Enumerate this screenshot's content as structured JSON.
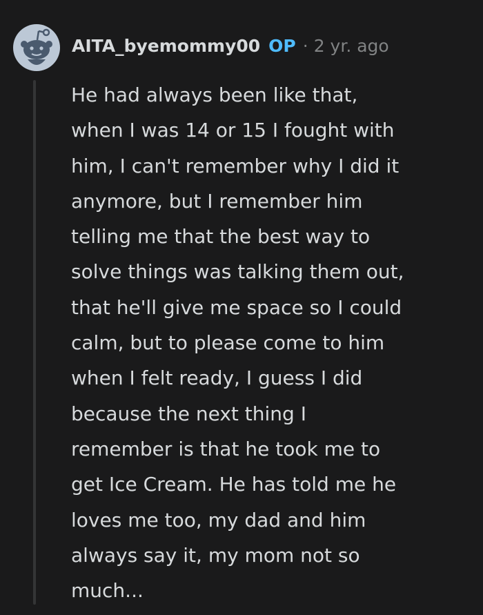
{
  "comment": {
    "avatar_icon": "reddit-snoo-avatar-icon",
    "username": "AITA_byemommy00",
    "op_badge": "OP",
    "separator": "·",
    "timestamp": "2 yr. ago",
    "body": "He had always been like that,\nwhen I was 14 or 15 I fought with\nhim, I can't remember why I did it\nanymore, but I remember him\ntelling me that the best way to\nsolve things was talking them out,\nthat he'll give me space so I could\ncalm, but to please come to him\nwhen I felt ready, I guess I did\nbecause the next thing I\nremember is that he took me to\nget Ice Cream. He has told me he\nloves me too, my dad and him\nalways say it, my mom not so\nmuch..."
  },
  "colors": {
    "background": "#1a1a1b",
    "text": "#d7dadc",
    "meta": "#818384",
    "op": "#4fbcff",
    "thread_line": "#343536",
    "avatar_bg": "#bcc8d6",
    "avatar_fg": "#4a5a6e"
  }
}
